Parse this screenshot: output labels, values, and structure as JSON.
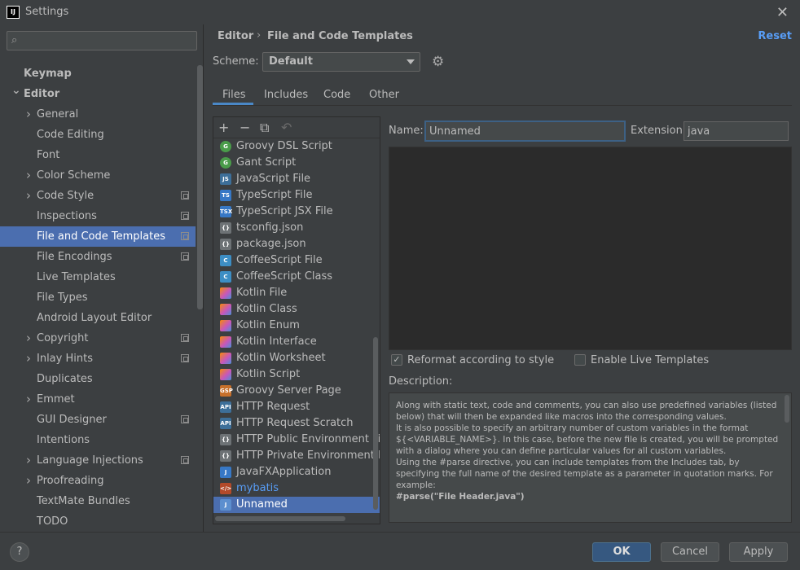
{
  "window": {
    "title": "Settings",
    "logo": "IJ"
  },
  "search": {
    "placeholder": ""
  },
  "nav": {
    "items": [
      {
        "label": "Keymap",
        "bold": true,
        "arrow": "",
        "level": 0,
        "badge": false,
        "selected": false
      },
      {
        "label": "Editor",
        "bold": true,
        "arrow": "v",
        "level": 0,
        "badge": false,
        "selected": false
      },
      {
        "label": "General",
        "bold": false,
        "arrow": ">",
        "level": 1,
        "badge": false,
        "selected": false
      },
      {
        "label": "Code Editing",
        "bold": false,
        "arrow": "",
        "level": 1,
        "badge": false,
        "selected": false
      },
      {
        "label": "Font",
        "bold": false,
        "arrow": "",
        "level": 1,
        "badge": false,
        "selected": false
      },
      {
        "label": "Color Scheme",
        "bold": false,
        "arrow": ">",
        "level": 1,
        "badge": false,
        "selected": false
      },
      {
        "label": "Code Style",
        "bold": false,
        "arrow": ">",
        "level": 1,
        "badge": true,
        "selected": false
      },
      {
        "label": "Inspections",
        "bold": false,
        "arrow": "",
        "level": 1,
        "badge": true,
        "selected": false
      },
      {
        "label": "File and Code Templates",
        "bold": false,
        "arrow": "",
        "level": 1,
        "badge": true,
        "selected": true
      },
      {
        "label": "File Encodings",
        "bold": false,
        "arrow": "",
        "level": 1,
        "badge": true,
        "selected": false
      },
      {
        "label": "Live Templates",
        "bold": false,
        "arrow": "",
        "level": 1,
        "badge": false,
        "selected": false
      },
      {
        "label": "File Types",
        "bold": false,
        "arrow": "",
        "level": 1,
        "badge": false,
        "selected": false
      },
      {
        "label": "Android Layout Editor",
        "bold": false,
        "arrow": "",
        "level": 1,
        "badge": false,
        "selected": false
      },
      {
        "label": "Copyright",
        "bold": false,
        "arrow": ">",
        "level": 1,
        "badge": true,
        "selected": false
      },
      {
        "label": "Inlay Hints",
        "bold": false,
        "arrow": ">",
        "level": 1,
        "badge": true,
        "selected": false
      },
      {
        "label": "Duplicates",
        "bold": false,
        "arrow": "",
        "level": 1,
        "badge": false,
        "selected": false
      },
      {
        "label": "Emmet",
        "bold": false,
        "arrow": ">",
        "level": 1,
        "badge": false,
        "selected": false
      },
      {
        "label": "GUI Designer",
        "bold": false,
        "arrow": "",
        "level": 1,
        "badge": true,
        "selected": false
      },
      {
        "label": "Intentions",
        "bold": false,
        "arrow": "",
        "level": 1,
        "badge": false,
        "selected": false
      },
      {
        "label": "Language Injections",
        "bold": false,
        "arrow": ">",
        "level": 1,
        "badge": true,
        "selected": false
      },
      {
        "label": "Proofreading",
        "bold": false,
        "arrow": ">",
        "level": 1,
        "badge": false,
        "selected": false
      },
      {
        "label": "TextMate Bundles",
        "bold": false,
        "arrow": "",
        "level": 1,
        "badge": false,
        "selected": false
      },
      {
        "label": "TODO",
        "bold": false,
        "arrow": "",
        "level": 1,
        "badge": false,
        "selected": false
      }
    ]
  },
  "header": {
    "breadcrumb_editor": "Editor",
    "breadcrumb_sep": "›",
    "breadcrumb_current": "File and Code Templates",
    "reset": "Reset"
  },
  "scheme": {
    "label": "Scheme:",
    "value": "Default"
  },
  "tabs": [
    {
      "label": "Files",
      "active": true
    },
    {
      "label": "Includes",
      "active": false
    },
    {
      "label": "Code",
      "active": false
    },
    {
      "label": "Other",
      "active": false
    }
  ],
  "toolbar": {
    "add": "+",
    "remove": "−",
    "copy": "⧉",
    "revert": "↶"
  },
  "templates": [
    {
      "label": "Groovy DSL Script",
      "icon": "groovy",
      "glyph": "G"
    },
    {
      "label": "Gant Script",
      "icon": "groovy",
      "glyph": "G"
    },
    {
      "label": "JavaScript File",
      "icon": "js",
      "glyph": "JS"
    },
    {
      "label": "TypeScript File",
      "icon": "ts",
      "glyph": "TS"
    },
    {
      "label": "TypeScript JSX File",
      "icon": "ts",
      "glyph": "TSX"
    },
    {
      "label": "tsconfig.json",
      "icon": "json",
      "glyph": "{}"
    },
    {
      "label": "package.json",
      "icon": "json",
      "glyph": "{}"
    },
    {
      "label": "CoffeeScript File",
      "icon": "coffee",
      "glyph": "C"
    },
    {
      "label": "CoffeeScript Class",
      "icon": "coffee",
      "glyph": "C"
    },
    {
      "label": "Kotlin File",
      "icon": "kotlin",
      "glyph": ""
    },
    {
      "label": "Kotlin Class",
      "icon": "kotlin",
      "glyph": ""
    },
    {
      "label": "Kotlin Enum",
      "icon": "kotlin",
      "glyph": ""
    },
    {
      "label": "Kotlin Interface",
      "icon": "kotlin",
      "glyph": ""
    },
    {
      "label": "Kotlin Worksheet",
      "icon": "kotlin",
      "glyph": ""
    },
    {
      "label": "Kotlin Script",
      "icon": "kotlin",
      "glyph": ""
    },
    {
      "label": "Groovy Server Page",
      "icon": "gsp",
      "glyph": "GSP"
    },
    {
      "label": "HTTP Request",
      "icon": "http",
      "glyph": "API"
    },
    {
      "label": "HTTP Request Scratch",
      "icon": "http",
      "glyph": "API"
    },
    {
      "label": "HTTP Public Environment File",
      "icon": "json",
      "glyph": "{}"
    },
    {
      "label": "HTTP Private Environment File",
      "icon": "json",
      "glyph": "{}"
    },
    {
      "label": "JavaFXApplication",
      "icon": "javafx",
      "glyph": "J"
    },
    {
      "label": "mybatis",
      "icon": "mybatis",
      "glyph": "</>",
      "blue": true
    },
    {
      "label": "Unnamed",
      "icon": "unnamed",
      "glyph": "J",
      "selected": true
    }
  ],
  "editor": {
    "name_label": "Name:",
    "name_value": "Unnamed",
    "ext_label": "Extension:",
    "ext_value": "java",
    "reformat_label": "Reformat according to style",
    "reformat_checked": "✓",
    "live_label": "Enable Live Templates",
    "live_checked": ""
  },
  "description": {
    "label": "Description:",
    "lines": [
      "Along with static text, code and comments, you can also use predefined variables (listed below) that will then be expanded like macros into the corresponding values.",
      "It is also possible to specify an arbitrary number of custom variables in the format ${<VARIABLE_NAME>}. In this case, before the new file is created, you will be prompted with a dialog where you can define particular values for all custom variables.",
      "Using the #parse directive, you can include templates from the Includes tab, by specifying the full name of the desired template as a parameter in quotation marks. For example:",
      "#parse(\"File Header.java\")"
    ]
  },
  "footer": {
    "help": "?",
    "ok": "OK",
    "cancel": "Cancel",
    "apply": "Apply"
  },
  "colors": {
    "accent": "#4b6eaf",
    "link": "#589df6",
    "background": "#3c3f41",
    "editor_bg": "#2b2b2b"
  }
}
